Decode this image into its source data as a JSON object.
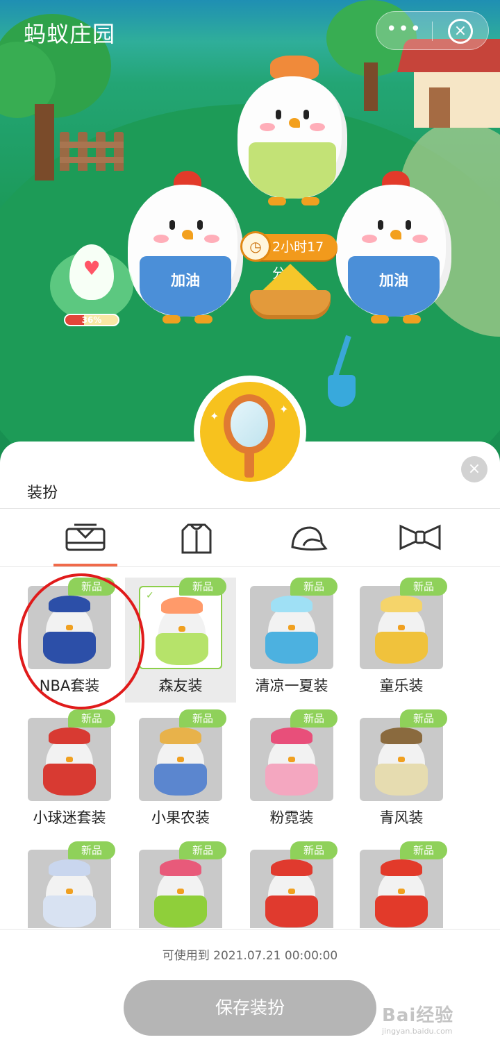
{
  "app": {
    "title": "蚂蚁庄园"
  },
  "capsule": {
    "more_label": "•••",
    "close_label": "×"
  },
  "scene": {
    "timer": "2小时17分",
    "egg_progress_text": "36%",
    "egg_progress": 0.36,
    "chicks": [
      {
        "overall_text": ""
      },
      {
        "overall_text": "加油"
      },
      {
        "overall_text": "加油"
      }
    ],
    "accent_color": "#f29a1c"
  },
  "sheet": {
    "title": "装扮",
    "close_label": "×",
    "tabs": [
      {
        "icon": "outfit-icon",
        "active": true
      },
      {
        "icon": "jacket-icon",
        "active": false
      },
      {
        "icon": "hat-icon",
        "active": false
      },
      {
        "icon": "bow-icon",
        "active": false
      }
    ],
    "badge_text": "新品",
    "items": [
      {
        "label": "NBA套装",
        "outfit": "#2c4fa8",
        "hat": "#2c4fa8",
        "selected": false
      },
      {
        "label": "森友装",
        "outfit": "#b6e36a",
        "hat": "#ff9a6a",
        "selected": true
      },
      {
        "label": "清凉一夏装",
        "outfit": "#4cb1e0",
        "hat": "#9fe0f5",
        "selected": false
      },
      {
        "label": "童乐装",
        "outfit": "#f0c23c",
        "hat": "#f5d46a",
        "selected": false
      },
      {
        "label": "小球迷套装",
        "outfit": "#d83a32",
        "hat": "#d83a32",
        "selected": false
      },
      {
        "label": "小果农装",
        "outfit": "#5b86cf",
        "hat": "#e8b24a",
        "selected": false
      },
      {
        "label": "粉霓装",
        "outfit": "#f4a7c0",
        "hat": "#e84f7a",
        "selected": false
      },
      {
        "label": "青风装",
        "outfit": "#e6dcb0",
        "hat": "#8a6a3e",
        "selected": false
      },
      {
        "label": "",
        "outfit": "#d8e2f2",
        "hat": "#c9d6ee",
        "selected": false
      },
      {
        "label": "",
        "outfit": "#8fcf3a",
        "hat": "#e85a7a",
        "selected": false
      },
      {
        "label": "",
        "outfit": "#e03a2e",
        "hat": "#e03a2e",
        "selected": false
      },
      {
        "label": "",
        "outfit": "#e23a2a",
        "hat": "#e23a2a",
        "selected": false
      }
    ]
  },
  "footer": {
    "validity": "可使用到 2021.07.21 00:00:00",
    "save_label": "保存装扮"
  },
  "watermark": {
    "brand": "Bai经验",
    "url": "jingyan.baidu.com"
  }
}
